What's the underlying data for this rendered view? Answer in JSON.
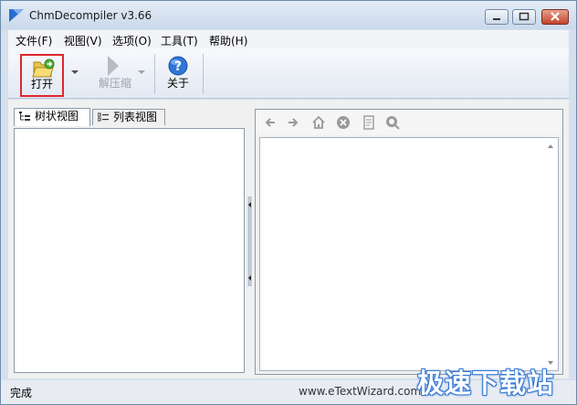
{
  "window": {
    "title": "ChmDecompiler v3.66"
  },
  "menu": {
    "items": [
      "文件(F)",
      "视图(V)",
      "选项(O)",
      "工具(T)",
      "帮助(H)"
    ]
  },
  "toolbar": {
    "open_label": "打开",
    "extract_label": "解压缩",
    "about_label": "关于"
  },
  "tabs": [
    {
      "label": "树状视图",
      "active": true
    },
    {
      "label": "列表视图",
      "active": false
    }
  ],
  "nav": {
    "icons": [
      "back-arrow-icon",
      "forward-arrow-icon",
      "home-icon",
      "stop-icon",
      "print-icon",
      "search-icon"
    ]
  },
  "status": {
    "text": "完成",
    "url": "www.eTextWizard.com"
  },
  "watermark": {
    "text": "极速下载站"
  },
  "colors": {
    "highlight_border": "#e0262b",
    "chrome": "#d5e0ee"
  }
}
